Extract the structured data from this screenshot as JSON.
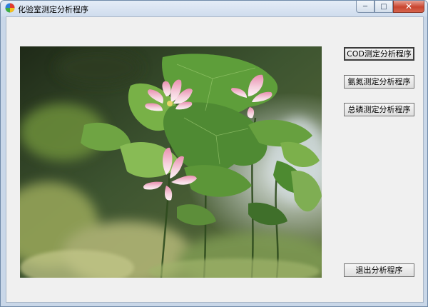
{
  "window": {
    "title": "化验室测定分析程序",
    "icon": "app-icon",
    "controls": {
      "minimize": "─",
      "maximize": "□",
      "close": "✕"
    }
  },
  "buttons": {
    "cod": "COD测定分析程序",
    "ammonia": "氨氮测定分析程序",
    "phosphorus": "总磷测定分析程序",
    "exit": "退出分析程序"
  },
  "colors": {
    "lotus_pink": "#f3c3d4",
    "leaf_green": "#5c9a3c",
    "close_red": "#c9452f"
  }
}
